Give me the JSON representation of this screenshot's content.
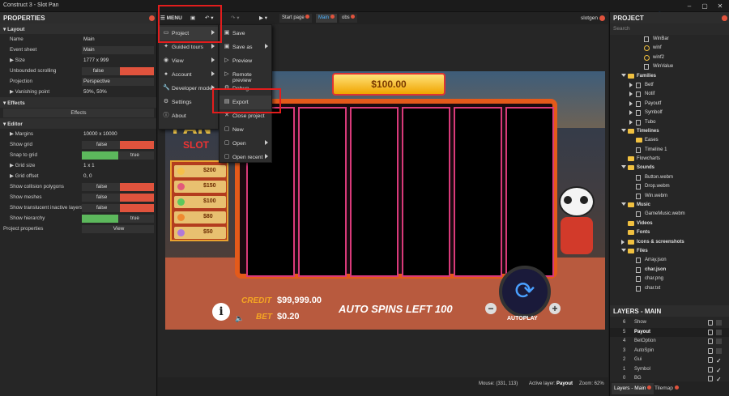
{
  "window": {
    "title": "Construct 3 - Slot Pan"
  },
  "properties": {
    "header": "PROPERTIES",
    "layout_section": "Layout",
    "rows": [
      {
        "label": "Name",
        "value": "Main"
      },
      {
        "label": "Event sheet",
        "value": "Main"
      },
      {
        "label": "Size",
        "value": "1777 x 999"
      },
      {
        "label": "Unbounded scrolling",
        "value": "false"
      },
      {
        "label": "Projection",
        "value": "Perspective"
      },
      {
        "label": "Vanishing point",
        "value": "50%, 50%"
      }
    ],
    "effects_section": "Effects",
    "effects_button": "Effects",
    "editor_section": "Editor",
    "editor_rows": [
      {
        "label": "Margins",
        "value": "10000 x 10000"
      },
      {
        "label": "Show grid",
        "value": "false"
      },
      {
        "label": "Snap to grid",
        "value": "true"
      },
      {
        "label": "Grid size",
        "value": "1 x 1"
      },
      {
        "label": "Grid offset",
        "value": "0, 0"
      },
      {
        "label": "Show collision polygons",
        "value": "false"
      },
      {
        "label": "Show meshes",
        "value": "false"
      },
      {
        "label": "Show translucent inactive layers",
        "value": "false"
      },
      {
        "label": "Show hierarchy",
        "value": "true"
      }
    ],
    "project_properties": {
      "label": "Project properties",
      "button": "View"
    }
  },
  "toolbar": {
    "menu_label": "MENU",
    "tabs": [
      "Start page",
      "Main",
      "obs"
    ],
    "user": "slotgen"
  },
  "main_menu": [
    {
      "label": "Project",
      "icon": "project-icon",
      "submenu": true
    },
    {
      "label": "Guided tours",
      "icon": "tours-icon",
      "submenu": true
    },
    {
      "label": "View",
      "icon": "eye-icon",
      "submenu": true
    },
    {
      "label": "Account",
      "icon": "account-icon",
      "submenu": true
    },
    {
      "label": "Developer mode",
      "icon": "wrench-icon",
      "submenu": true
    },
    {
      "label": "Settings",
      "icon": "gear-icon",
      "submenu": false
    },
    {
      "label": "About",
      "icon": "info-icon",
      "submenu": false
    }
  ],
  "project_menu": [
    {
      "label": "Save",
      "submenu": false
    },
    {
      "label": "Save as",
      "submenu": true
    },
    {
      "label": "Preview",
      "submenu": false
    },
    {
      "label": "Remote preview",
      "submenu": false
    },
    {
      "label": "Debug",
      "submenu": false
    },
    {
      "label": "Export",
      "submenu": false
    },
    {
      "label": "Close project",
      "submenu": false
    },
    {
      "label": "New",
      "submenu": false
    },
    {
      "label": "Open",
      "submenu": true
    },
    {
      "label": "Open recent",
      "submenu": true
    }
  ],
  "game": {
    "jackpot": "$100.00",
    "title_partial": "PAN",
    "title_line2": "SLOT",
    "paytable": [
      "$200",
      "$150",
      "$100",
      "$80",
      "$50"
    ],
    "credit_label": "CREDIT",
    "credit_value": "$99,999.00",
    "bet_label": "BET",
    "bet_value": "$0.20",
    "auto_spins": "AUTO SPINS LEFT 100",
    "autoplay": "AUTOPLAY",
    "reel_count": 6
  },
  "statusbar": {
    "mouse": "Mouse: (331, 113)",
    "active_layer": "Active layer:",
    "active_layer_value": "Payout",
    "zoom": "Zoom: 62%"
  },
  "project": {
    "header": "PROJECT",
    "search_placeholder": "Search",
    "tree": [
      {
        "label": "WinBar",
        "indent": 3,
        "type": "file"
      },
      {
        "label": "winf",
        "indent": 3,
        "type": "circle"
      },
      {
        "label": "winf2",
        "indent": 3,
        "type": "circle"
      },
      {
        "label": "WinValue",
        "indent": 3,
        "type": "file"
      },
      {
        "label": "Families",
        "indent": 1,
        "type": "folder",
        "expanded": true,
        "bold": true
      },
      {
        "label": "Betf",
        "indent": 2,
        "type": "file",
        "collapsed": true
      },
      {
        "label": "Notif",
        "indent": 2,
        "type": "file",
        "collapsed": true
      },
      {
        "label": "Payoutf",
        "indent": 2,
        "type": "file",
        "collapsed": true
      },
      {
        "label": "Symbolf",
        "indent": 2,
        "type": "file",
        "collapsed": true
      },
      {
        "label": "Tubo",
        "indent": 2,
        "type": "file",
        "collapsed": true
      },
      {
        "label": "Timelines",
        "indent": 1,
        "type": "folder",
        "expanded": true,
        "bold": true
      },
      {
        "label": "Eases",
        "indent": 2,
        "type": "folder"
      },
      {
        "label": "Timeline 1",
        "indent": 2,
        "type": "file"
      },
      {
        "label": "Flowcharts",
        "indent": 1,
        "type": "folder"
      },
      {
        "label": "Sounds",
        "indent": 1,
        "type": "folder",
        "expanded": true,
        "bold": true
      },
      {
        "label": "Button.webm",
        "indent": 2,
        "type": "file"
      },
      {
        "label": "Drop.webm",
        "indent": 2,
        "type": "file"
      },
      {
        "label": "Win.webm",
        "indent": 2,
        "type": "file"
      },
      {
        "label": "Music",
        "indent": 1,
        "type": "folder",
        "expanded": true,
        "bold": true
      },
      {
        "label": "GameMusic.webm",
        "indent": 2,
        "type": "file"
      },
      {
        "label": "Videos",
        "indent": 1,
        "type": "folder",
        "bold": true
      },
      {
        "label": "Fonts",
        "indent": 1,
        "type": "folder",
        "bold": true
      },
      {
        "label": "Icons & screenshots",
        "indent": 1,
        "type": "folder",
        "collapsed": true,
        "bold": true
      },
      {
        "label": "Files",
        "indent": 1,
        "type": "folder",
        "expanded": true,
        "bold": true
      },
      {
        "label": "Array.json",
        "indent": 2,
        "type": "file"
      },
      {
        "label": "char.json",
        "indent": 2,
        "type": "file",
        "bold": true
      },
      {
        "label": "char.png",
        "indent": 2,
        "type": "file"
      },
      {
        "label": "char.txt",
        "indent": 2,
        "type": "file"
      }
    ]
  },
  "layers": {
    "header": "LAYERS - MAIN",
    "rows": [
      {
        "num": "6",
        "name": "Show",
        "visible": false
      },
      {
        "num": "5",
        "name": "Payout",
        "visible": false,
        "selected": true
      },
      {
        "num": "4",
        "name": "BetOption",
        "visible": false
      },
      {
        "num": "3",
        "name": "AutoSpin",
        "visible": false
      },
      {
        "num": "2",
        "name": "Gui",
        "visible": true
      },
      {
        "num": "1",
        "name": "Symbol",
        "visible": true
      },
      {
        "num": "0",
        "name": "BG",
        "visible": true
      }
    ],
    "tabs": [
      "Layers - Main",
      "Tilemap"
    ]
  }
}
